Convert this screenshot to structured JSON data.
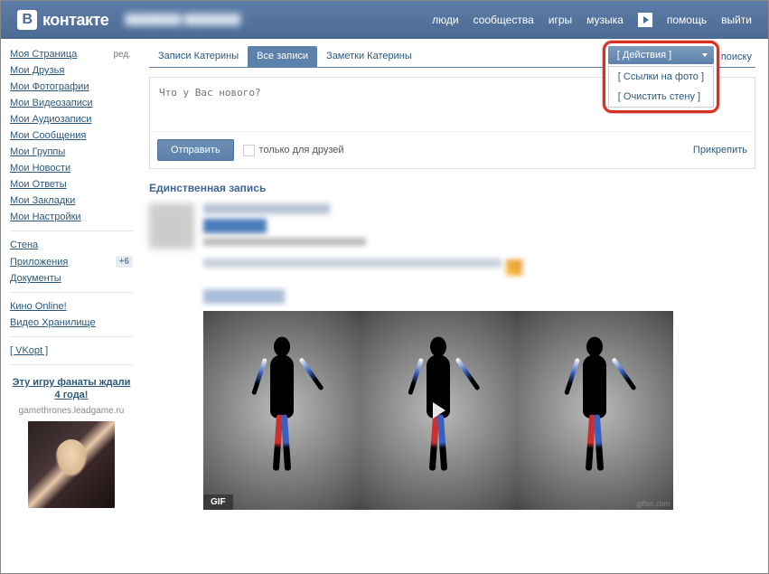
{
  "header": {
    "logo_text": "контакте",
    "logo_letter": "В",
    "nav": {
      "people": "люди",
      "communities": "сообщества",
      "games": "игры",
      "music": "музыка",
      "help": "помощь",
      "logout": "выйти"
    }
  },
  "sidebar": {
    "items": [
      {
        "label": "Моя Страница",
        "tag": "ред."
      },
      {
        "label": "Мои Друзья"
      },
      {
        "label": "Мои Фотографии"
      },
      {
        "label": "Мои Видеозаписи"
      },
      {
        "label": "Мои Аудиозаписи"
      },
      {
        "label": "Мои Сообщения"
      },
      {
        "label": "Мои Группы"
      },
      {
        "label": "Мои Новости"
      },
      {
        "label": "Мои Ответы"
      },
      {
        "label": "Мои Закладки"
      },
      {
        "label": "Мои Настройки"
      }
    ],
    "group2": [
      {
        "label": "Стена"
      },
      {
        "label": "Приложения",
        "badge": "+6"
      },
      {
        "label": "Документы"
      }
    ],
    "group3": [
      {
        "label": "Кино Online!"
      },
      {
        "label": "Видео Хранилище"
      }
    ],
    "group4": [
      {
        "label": "[ VKopt ]"
      }
    ],
    "ad": {
      "title": "Эту игру фанаты ждали 4 года!",
      "sub": "gamethrones.leadgame.ru"
    }
  },
  "tabs": {
    "t1": "Записи Катерины",
    "t2": "Все записи",
    "t3": "Заметки Катерины",
    "search": "к поиску"
  },
  "dropdown": {
    "button": "[ Действия ]",
    "item1": "[ Ссылки на фото ]",
    "item2": "[ Очистить стену ]"
  },
  "postbox": {
    "placeholder": "Что у Вас нового?",
    "submit": "Отправить",
    "friends_only": "только для друзей",
    "attach": "Прикрепить"
  },
  "wall": {
    "heading": "Единственная запись",
    "gif_badge": "GIF",
    "gif_src": "gifbin.com"
  }
}
